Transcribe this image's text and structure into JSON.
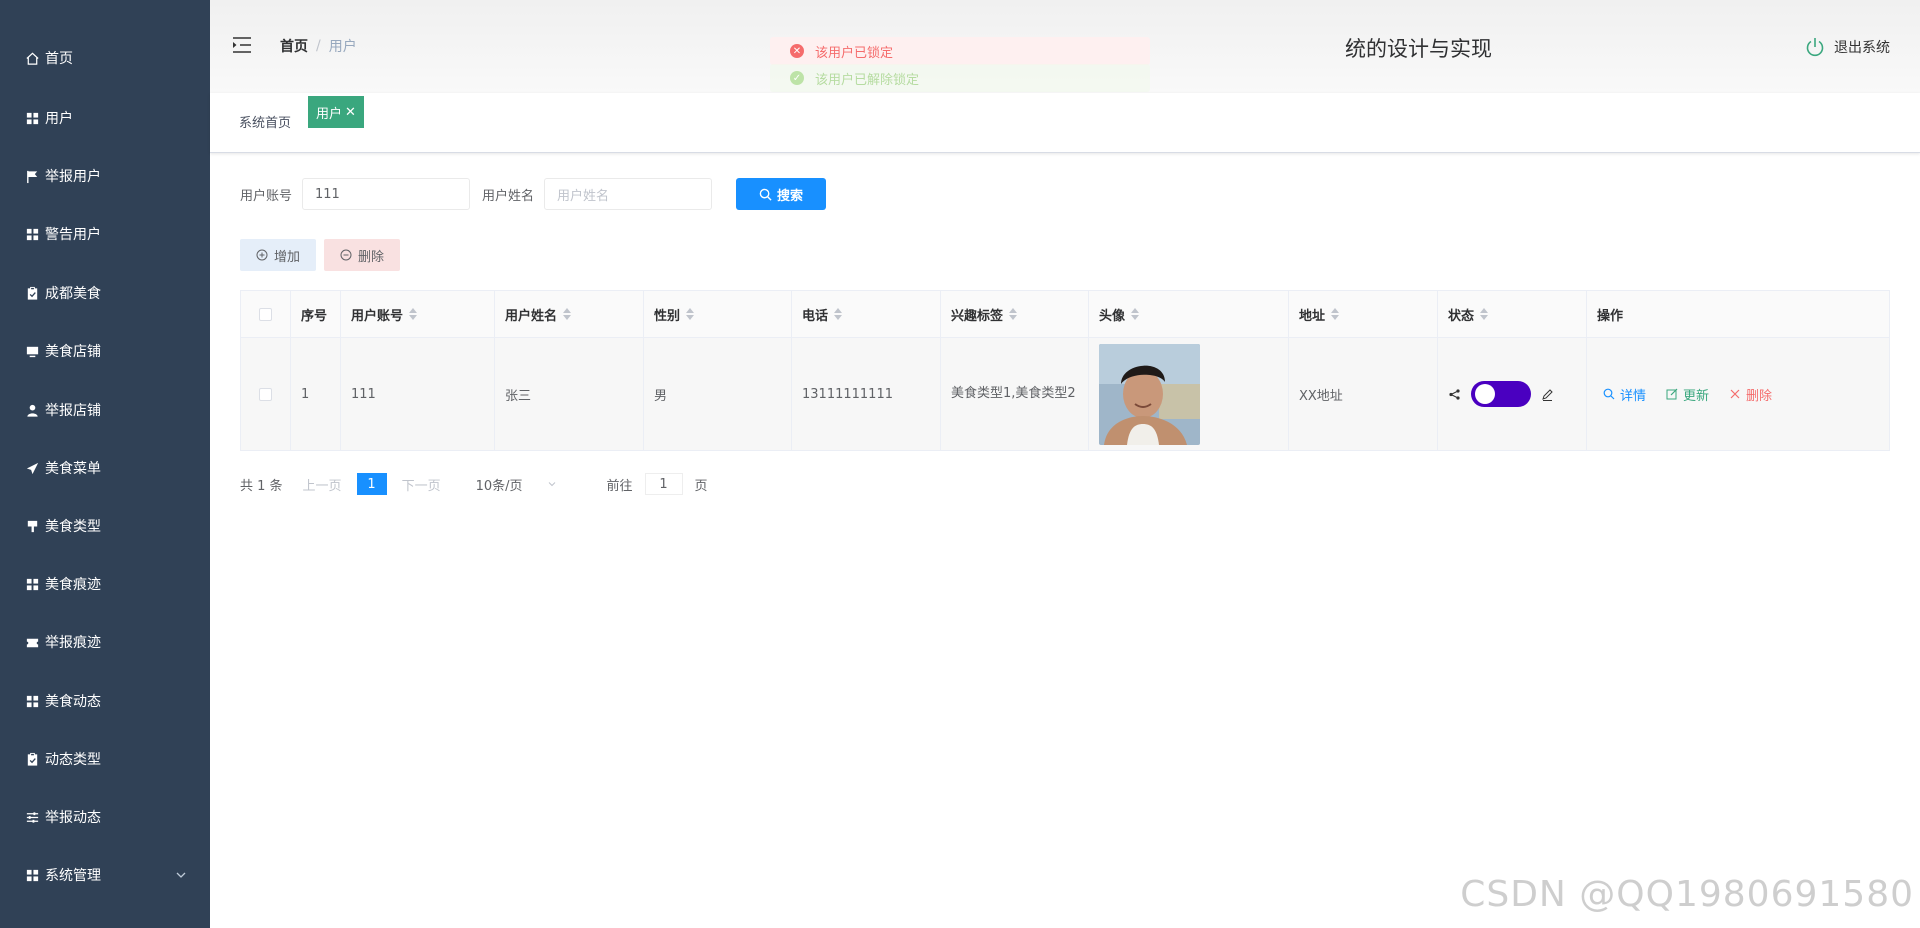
{
  "sidebar": {
    "items": [
      {
        "label": "首页",
        "icon": "home-icon"
      },
      {
        "label": "用户",
        "icon": "grid-icon"
      },
      {
        "label": "举报用户",
        "icon": "flag-icon"
      },
      {
        "label": "警告用户",
        "icon": "grid-icon"
      },
      {
        "label": "成都美食",
        "icon": "clipboard-icon"
      },
      {
        "label": "美食店铺",
        "icon": "monitor-icon"
      },
      {
        "label": "举报店铺",
        "icon": "user-icon"
      },
      {
        "label": "美食菜单",
        "icon": "send-icon"
      },
      {
        "label": "美食类型",
        "icon": "brush-icon"
      },
      {
        "label": "美食痕迹",
        "icon": "grid-icon"
      },
      {
        "label": "举报痕迹",
        "icon": "ticket-icon"
      },
      {
        "label": "美食动态",
        "icon": "grid-icon"
      },
      {
        "label": "动态类型",
        "icon": "clipboard-icon"
      },
      {
        "label": "举报动态",
        "icon": "sliders-icon"
      },
      {
        "label": "系统管理",
        "icon": "grid-icon"
      }
    ]
  },
  "header": {
    "breadcrumb_home": "首页",
    "breadcrumb_sep": "/",
    "breadcrumb_current": "用户",
    "title": "统的设计与实现",
    "logout_label": "退出系统"
  },
  "toasts": {
    "error": "该用户已锁定",
    "success": "该用户已解除锁定"
  },
  "tags": {
    "home": "系统首页",
    "active": "用户",
    "close": "✕"
  },
  "search": {
    "account_label": "用户账号",
    "account_value": "111",
    "name_label": "用户姓名",
    "name_placeholder": "用户姓名",
    "button_label": "搜索"
  },
  "actions": {
    "add_label": "增加",
    "delete_label": "删除"
  },
  "table": {
    "headers": [
      "序号",
      "用户账号",
      "用户姓名",
      "性别",
      "电话",
      "兴趣标签",
      "头像",
      "地址",
      "状态",
      "操作"
    ],
    "rows": [
      {
        "no": "1",
        "account": "111",
        "name": "张三",
        "sex": "男",
        "phone": "13111111111",
        "tags": "美食类型1,美食类型2",
        "address": "XX地址",
        "ops": {
          "detail": "详情",
          "update": "更新",
          "delete": "删除"
        }
      }
    ]
  },
  "pager": {
    "total": "共 1 条",
    "prev": "上一页",
    "current": "1",
    "next": "下一页",
    "page_size": "10条/页",
    "goto_label": "前往",
    "goto_value": "1",
    "goto_unit": "页"
  },
  "watermark": "CSDN @QQ1980691580",
  "colors": {
    "sidebar_bg": "#304156",
    "primary": "#1890ff",
    "tag_active": "#3aa77e",
    "danger": "#f56c6c",
    "toggle": "#4a00c0"
  }
}
